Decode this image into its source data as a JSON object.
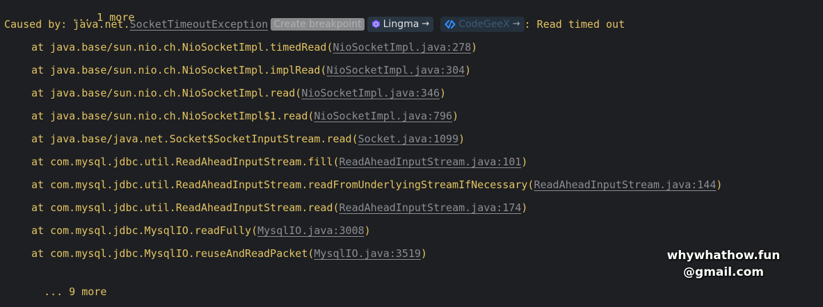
{
  "console": {
    "top_truncated": "... 1 more",
    "caused_prefix": "Caused by: java.net.",
    "exception_class": "SocketTimeoutException",
    "create_breakpoint": "Create breakpoint",
    "lingma_label": "Lingma",
    "codegeex_label": "CodeGeeX",
    "arrow": "→",
    "message": ": Read timed out",
    "frames": [
      {
        "at": "at java.base/sun.nio.ch.NioSocketImpl.timedRead(",
        "link": "NioSocketImpl.java:278",
        "close": ")"
      },
      {
        "at": "at java.base/sun.nio.ch.NioSocketImpl.implRead(",
        "link": "NioSocketImpl.java:304",
        "close": ")"
      },
      {
        "at": "at java.base/sun.nio.ch.NioSocketImpl.read(",
        "link": "NioSocketImpl.java:346",
        "close": ")"
      },
      {
        "at": "at java.base/sun.nio.ch.NioSocketImpl$1.read(",
        "link": "NioSocketImpl.java:796",
        "close": ")"
      },
      {
        "at": "at java.base/java.net.Socket$SocketInputStream.read(",
        "link": "Socket.java:1099",
        "close": ")"
      },
      {
        "at": "at com.mysql.jdbc.util.ReadAheadInputStream.fill(",
        "link": "ReadAheadInputStream.java:101",
        "close": ")"
      },
      {
        "at": "at com.mysql.jdbc.util.ReadAheadInputStream.readFromUnderlyingStreamIfNecessary(",
        "link": "ReadAheadInputStream.java:144",
        "close": ")"
      },
      {
        "at": "at com.mysql.jdbc.util.ReadAheadInputStream.read(",
        "link": "ReadAheadInputStream.java:174",
        "close": ")"
      },
      {
        "at": "at com.mysql.jdbc.MysqlIO.readFully(",
        "link": "MysqlIO.java:3008",
        "close": ")"
      },
      {
        "at": "at com.mysql.jdbc.MysqlIO.reuseAndReadPacket(",
        "link": "MysqlIO.java:3519",
        "close": ")"
      }
    ],
    "bottom_truncated": "... 9 more"
  },
  "watermark": {
    "line1": "whywhathow.fun",
    "line2": "@gmail.com"
  },
  "colors": {
    "background": "#1e1f22",
    "text": "#e2c463",
    "link": "#8b8d92"
  },
  "icons": {
    "lingma": "lingma-logo-icon",
    "codegeex": "codegeex-logo-icon",
    "arrow": "arrow-right-icon"
  }
}
